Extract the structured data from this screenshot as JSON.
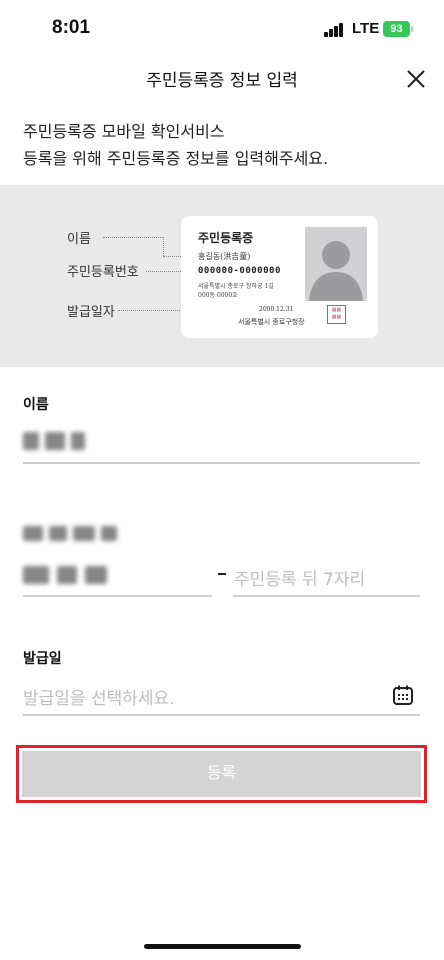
{
  "status_bar": {
    "time": "8:01",
    "network": "LTE",
    "battery": "93"
  },
  "header": {
    "title": "주민등록증 정보 입력",
    "close_icon": "close-icon"
  },
  "intro": {
    "line1": "주민등록증 모바일 확인서비스",
    "line2": "등록을 위해 주민등록증 정보를 입력해주세요."
  },
  "card_guide": {
    "label_name": "이름",
    "label_regno": "주민등록번호",
    "label_date": "발급일자",
    "card": {
      "title": "주민등록증",
      "holder": "홍길동(洪吉童)",
      "number": "000000-0000000",
      "address_line1": "서울특별시 종로구 창하궁 1길",
      "address_line2": "000동 0000호",
      "issue_date": "2000.12.31",
      "issuer": "서울특별시 종로구청장"
    }
  },
  "form": {
    "name": {
      "label": "이름"
    },
    "regno": {
      "back_placeholder": "주민등록 뒤 7자리"
    },
    "issue_date": {
      "label": "발급일",
      "placeholder": "발급일을 선택하세요.",
      "icon": "calendar-icon"
    },
    "submit_label": "등록"
  },
  "colors": {
    "accent_outline": "#e3202b",
    "button_disabled": "#d4d4d4",
    "battery": "#34c759",
    "card_area_bg": "#e9e9ea"
  }
}
